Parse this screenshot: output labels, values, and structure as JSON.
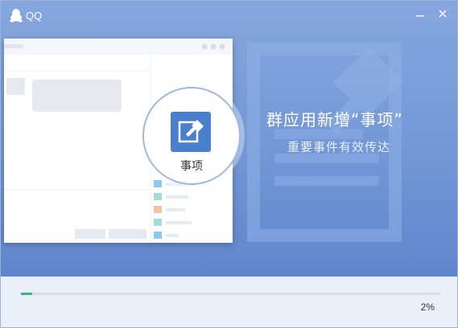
{
  "window": {
    "title": "QQ",
    "minimize_label": "—",
    "close_label": "✕",
    "icons": {
      "logo": "qq-penguin-icon",
      "minimize": "minimize-icon",
      "close": "close-icon"
    }
  },
  "feature": {
    "badge_label": "事项",
    "badge_icon": "pin-note-icon",
    "headline": "群应用新增“事项”",
    "subline": "重要事件有效传达"
  },
  "progress": {
    "percent": 2,
    "text": "2%"
  },
  "colors": {
    "banner_top": "#86a7df",
    "banner_bottom": "#5f86cd",
    "accent": "#4a7fd0",
    "progress_fill": "#48c04f"
  }
}
